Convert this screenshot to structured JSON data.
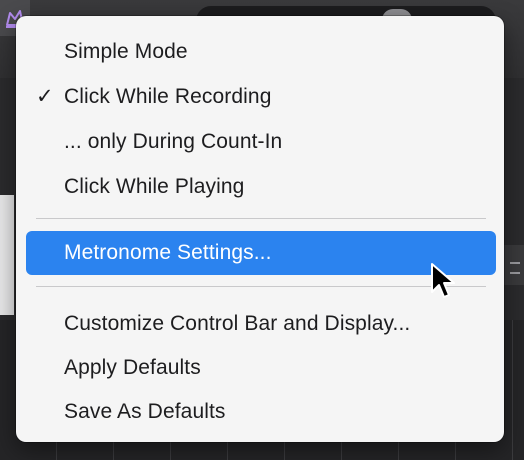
{
  "menu": {
    "items": [
      {
        "label": "Simple Mode",
        "checked": false,
        "highlighted": false
      },
      {
        "label": "Click While Recording",
        "checked": true,
        "highlighted": false
      },
      {
        "label": "... only During Count-In",
        "checked": false,
        "highlighted": false
      },
      {
        "label": "Click While Playing",
        "checked": false,
        "highlighted": false
      },
      {
        "label": "Metronome Settings...",
        "checked": false,
        "highlighted": true
      },
      {
        "label": "Customize Control Bar and Display...",
        "checked": false,
        "highlighted": false
      },
      {
        "label": "Apply Defaults",
        "checked": false,
        "highlighted": false
      },
      {
        "label": "Save As Defaults",
        "checked": false,
        "highlighted": false
      }
    ],
    "check_glyph": "✓",
    "colors": {
      "menu_background": "#f5f5f5",
      "highlight": "#2b83ef",
      "text": "#1d1d1f",
      "highlight_text": "#ffffff"
    }
  },
  "background": {
    "partial_char": "n",
    "accent_icon": "metronome-icon"
  },
  "cursor": {
    "icon": "arrow-cursor-icon"
  }
}
